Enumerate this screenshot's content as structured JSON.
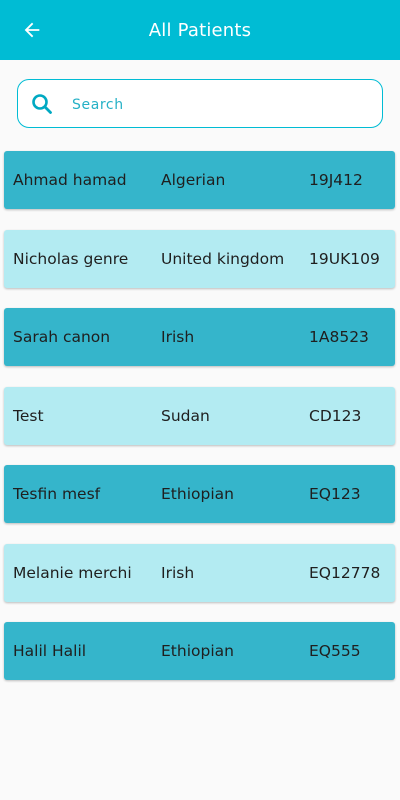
{
  "header": {
    "title": "All Patients",
    "back_icon": "arrow-left-icon"
  },
  "search": {
    "placeholder": "Search",
    "value": "",
    "icon": "search-icon"
  },
  "colors": {
    "primary": "#00bcd4",
    "row_dark": "#35b5cb",
    "row_light": "#b3ebf2"
  },
  "patients": [
    {
      "name": "Ahmad hamad",
      "nationality": "Algerian",
      "id": "19J412"
    },
    {
      "name": "Nicholas genre",
      "nationality": "United kingdom",
      "id": "19UK109"
    },
    {
      "name": "Sarah canon",
      "nationality": "Irish",
      "id": "1A8523"
    },
    {
      "name": "Test",
      "nationality": "Sudan",
      "id": "CD123"
    },
    {
      "name": "Tesfin mesf",
      "nationality": "Ethiopian",
      "id": "EQ123"
    },
    {
      "name": "Melanie merchi",
      "nationality": "Irish",
      "id": "EQ12778"
    },
    {
      "name": "Halil Halil",
      "nationality": "Ethiopian",
      "id": "EQ555"
    }
  ]
}
